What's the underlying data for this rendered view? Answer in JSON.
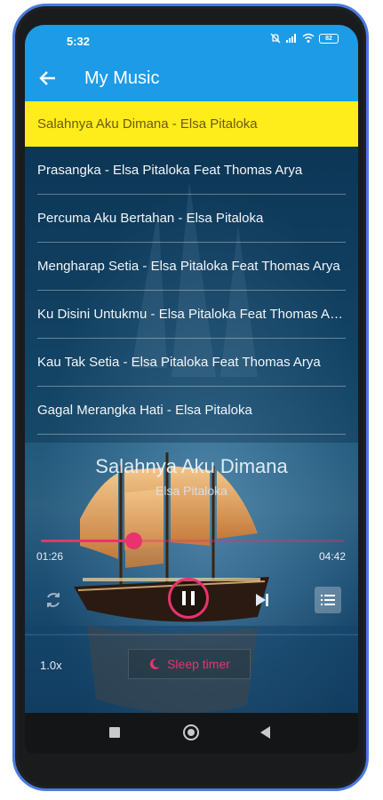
{
  "status_bar": {
    "time": "5:32",
    "battery": "82"
  },
  "app_bar": {
    "title": "My Music"
  },
  "songs": [
    "Salahnya Aku Dimana - Elsa Pitaloka",
    "Prasangka - Elsa Pitaloka Feat Thomas Arya",
    "Percuma Aku Bertahan - Elsa Pitaloka",
    "Mengharap Setia - Elsa Pitaloka Feat Thomas Arya",
    "Ku Disini Untukmu - Elsa Pitaloka Feat Thomas Arya",
    "Kau Tak Setia - Elsa Pitaloka Feat Thomas Arya",
    "Gagal Merangka Hati - Elsa Pitaloka"
  ],
  "player": {
    "title": "Salahnya Aku Dimana",
    "artist": "Elsa Pitaloka",
    "elapsed": "01:26",
    "total": "04:42",
    "progress": 0.305,
    "speed": "1.0x",
    "sleep_timer_label": "Sleep timer"
  },
  "colors": {
    "accent": "#1d9be6",
    "highlight": "#ffec1a",
    "player_accent": "#e8336e",
    "frame": "#4a7be0"
  },
  "icons": {
    "back": "arrow-left-icon",
    "repeat": "repeat-icon",
    "pause": "pause-icon",
    "next": "skip-next-icon",
    "playlist": "playlist-icon",
    "sleep": "moon-icon"
  }
}
